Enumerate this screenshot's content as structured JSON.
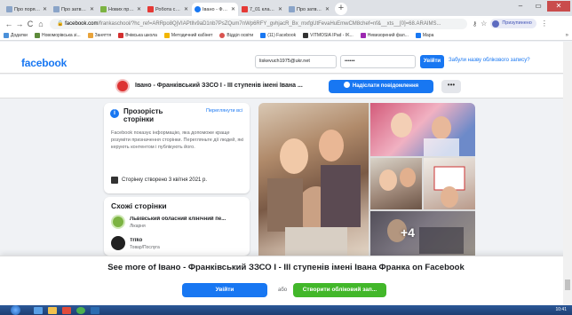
{
  "browser": {
    "tabs": [
      {
        "label": "Про порядок заро",
        "color": "#8aa4c8",
        "active": false
      },
      {
        "label": "Про затвердженн",
        "color": "#8aa4c8",
        "active": false
      },
      {
        "label": "Нових про вичини",
        "color": "#7cb342",
        "active": false
      },
      {
        "label": "Робота соціальн",
        "color": "#e53935",
        "active": false
      },
      {
        "label": "Івано - Франківс",
        "color": "#1877f2",
        "active": true
      },
      {
        "label": "7_01 клас Фізика",
        "color": "#e53935",
        "active": false
      },
      {
        "label": "Про затвердженн",
        "color": "#8aa4c8",
        "active": false
      }
    ],
    "url_domain": "facebook.com",
    "url_rest": "/frankaschool/?hc_ref=ARRpo8QjVIAPtIlv9aD1nb7PsZQum7nWp6RFY_gvhjacR_Bx_mxfgUtFevaHuEmwCM8chef=nf&__xts__[0]=68.ARAIMS...",
    "profile_label": "Призупинено",
    "bookmarks": [
      {
        "label": "Додатки",
        "color": "#4a90d9"
      },
      {
        "label": "Новоморівська зі...",
        "color": "#5d8a3a"
      },
      {
        "label": "Заняття",
        "color": "#e8a33b"
      },
      {
        "label": "Вчівська школа",
        "color": "#d32f2f"
      },
      {
        "label": "Методичний кабінет",
        "color": "#f2b600"
      },
      {
        "label": "Відділ освіти",
        "color": "#d9534f"
      },
      {
        "label": "(11) Facebook",
        "color": "#1877f2"
      },
      {
        "label": "VITMOSIA IPad - IK...",
        "color": "#333333"
      },
      {
        "label": "Невизорений фал...",
        "color": "#9c27b0"
      },
      {
        "label": "Mapa",
        "color": "#1877f2"
      }
    ]
  },
  "facebook": {
    "logo": "facebook",
    "email_value": "liskevuch1975@ukr.net",
    "password_value": "••••••",
    "login_label": "Увійти",
    "forgot_label": "Забули назву облікового запису?",
    "page_name": "Івано - Франківський ЗЗСО I - III ступенів імені Івана ...",
    "send_message_label": "Надіслати повідомлення",
    "more_label": "•••",
    "transparency": {
      "title": "Прозорість сторінки",
      "link": "Переглянути всі",
      "description": "Facebook показує інформацію, яка допоможе краще розуміти призначення сторінки. Перегляньте дії людей, які керують контентом і публікують його.",
      "created": "Сторінку створено 3 квітня 2021 р."
    },
    "similar": {
      "title": "Схожі сторінки",
      "items": [
        {
          "name": "Львівський обласний клінічний пе...",
          "category": "Лікарня",
          "color": "#7cb342"
        },
        {
          "name": "Triko",
          "category": "Товар/Послуга",
          "color": "#222222"
        }
      ]
    },
    "photos_more": "+4",
    "footer": {
      "see_more": "See more of Івано - Франківський ЗЗСО I - III ступенів імені Івана Франка on Facebook",
      "login": "Увійти",
      "or": "або",
      "create": "Створити обліковий зап..."
    }
  },
  "taskbar": {
    "clock": "10:41"
  }
}
